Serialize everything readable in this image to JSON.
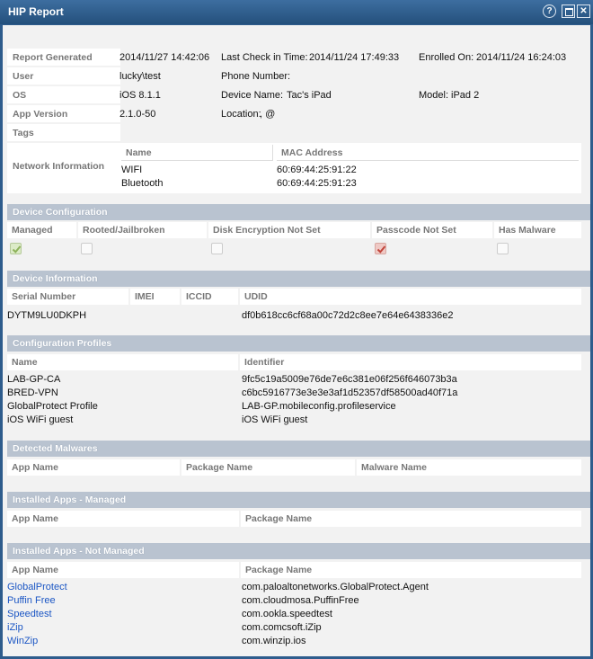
{
  "window": {
    "title": "HIP Report"
  },
  "icons": {
    "help": "help-icon",
    "maximize": "maximize-icon",
    "close": "close-icon"
  },
  "report": {
    "report_generated_label": "Report Generated",
    "report_generated_value": "2014/11/27 14:42:06",
    "last_check_label": "Last Check in Time:",
    "last_check_value": "2014/11/24 17:49:33",
    "enrolled_label": "Enrolled On:",
    "enrolled_value": "2014/11/24 16:24:03",
    "user_label": "User",
    "user_value": "lucky\\test",
    "phone_label": "Phone Number:",
    "phone_value": "",
    "os_label": "OS",
    "os_value": "iOS 8.1.1",
    "device_name_label": "Device Name:",
    "device_name_value": "Tac's iPad",
    "model_label": "Model:",
    "model_value": "iPad 2",
    "app_version_label": "App Version",
    "app_version_value": "2.1.0-50",
    "location_label": "Location:",
    "location_value": ", @",
    "tags_label": "Tags",
    "network_label": "Network Information",
    "network_headers": [
      "Name",
      "MAC Address"
    ],
    "network_rows": [
      {
        "name": "WIFI",
        "mac": "60:69:44:25:91:22"
      },
      {
        "name": "Bluetooth",
        "mac": "60:69:44:25:91:23"
      }
    ]
  },
  "device_configuration": {
    "title": "Device Configuration",
    "headers": [
      "Managed",
      "Rooted/Jailbroken",
      "Disk Encryption Not Set",
      "Passcode Not Set",
      "Has Malware"
    ],
    "values": [
      true,
      false,
      false,
      true,
      false
    ],
    "status_colors": {
      "managed": "#8db25a",
      "passcode": "#c0443a"
    }
  },
  "device_information": {
    "title": "Device Information",
    "headers": [
      "Serial Number",
      "IMEI",
      "ICCID",
      "UDID"
    ],
    "serial": "DYTM9LU0DKPH",
    "imei": "",
    "iccid": "",
    "udid": "df0b618cc6cf68a00c72d2c8ee7e64e6438336e2"
  },
  "configuration_profiles": {
    "title": "Configuration Profiles",
    "headers": [
      "Name",
      "Identifier"
    ],
    "rows": [
      {
        "name": "LAB-GP-CA",
        "identifier": "9fc5c19a5009e76de7e6c381e06f256f646073b3a"
      },
      {
        "name": "BRED-VPN",
        "identifier": "c6bc5916773e3e3e3af1d52357df58500ad40f71a"
      },
      {
        "name": "GlobalProtect Profile",
        "identifier": "LAB-GP.mobileconfig.profileservice"
      },
      {
        "name": "iOS WiFi guest",
        "identifier": "iOS WiFi guest"
      }
    ]
  },
  "detected_malwares": {
    "title": "Detected Malwares",
    "headers": [
      "App Name",
      "Package Name",
      "Malware Name"
    ]
  },
  "installed_managed": {
    "title": "Installed Apps - Managed",
    "headers": [
      "App Name",
      "Package Name"
    ]
  },
  "installed_not_managed": {
    "title": "Installed Apps - Not Managed",
    "headers": [
      "App Name",
      "Package Name"
    ],
    "rows": [
      {
        "app": "GlobalProtect",
        "package": "com.paloaltonetworks.GlobalProtect.Agent"
      },
      {
        "app": "Puffin Free",
        "package": "com.cloudmosa.PuffinFree"
      },
      {
        "app": "Speedtest",
        "package": "com.ookla.speedtest"
      },
      {
        "app": "iZip",
        "package": "com.comcsoft.iZip"
      },
      {
        "app": "WinZip",
        "package": "com.winzip.ios"
      }
    ]
  }
}
